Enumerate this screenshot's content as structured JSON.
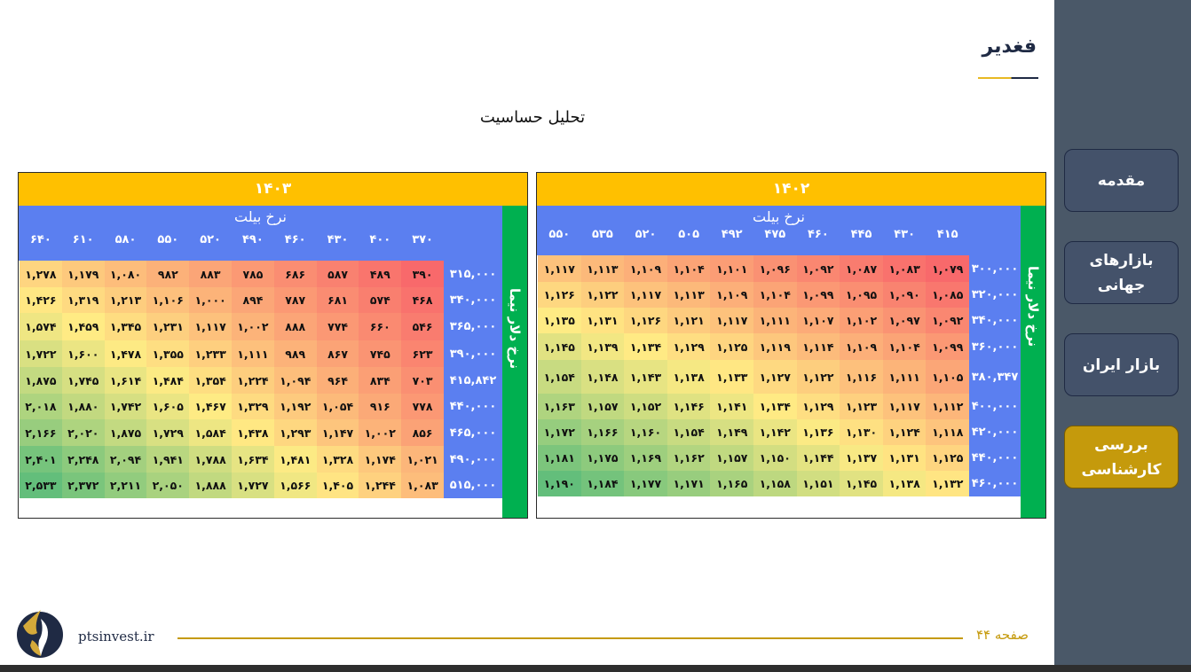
{
  "header": {
    "title": "فغدیر"
  },
  "section_title": "تحلیل حساسیت",
  "sidebar": {
    "items": [
      {
        "label": "مقدمه",
        "active": false
      },
      {
        "label": "بازارهای جهانی",
        "active": false
      },
      {
        "label": "بازار ایران",
        "active": false
      },
      {
        "label": "بررسی کارشناسی",
        "active": true
      }
    ]
  },
  "footer": {
    "site": "ptsinvest.ir",
    "page": "صفحه ۴۴"
  },
  "colors": {
    "accent": "#c59a0c",
    "sidebar": "#4a5868",
    "header_yellow": "#ffc000",
    "header_blue": "#5b7ff0",
    "strip_green": "#00b050"
  },
  "tables": [
    {
      "year": "۱۴۰۲",
      "col_title": "نرخ بیلت",
      "row_title": "نرخ دلار نیما",
      "columns": [
        "۴۱۵",
        "۴۳۰",
        "۴۴۵",
        "۴۶۰",
        "۴۷۵",
        "۴۹۲",
        "۵۰۵",
        "۵۲۰",
        "۵۳۵",
        "۵۵۰"
      ],
      "rows": [
        {
          "label": "۳۰۰,۰۰۰",
          "values": [
            "۱,۰۷۹",
            "۱,۰۸۳",
            "۱,۰۸۷",
            "۱,۰۹۲",
            "۱,۰۹۶",
            "۱,۱۰۱",
            "۱,۱۰۴",
            "۱,۱۰۹",
            "۱,۱۱۳",
            "۱,۱۱۷"
          ]
        },
        {
          "label": "۳۲۰,۰۰۰",
          "values": [
            "۱,۰۸۵",
            "۱,۰۹۰",
            "۱,۰۹۵",
            "۱,۰۹۹",
            "۱,۱۰۴",
            "۱,۱۰۹",
            "۱,۱۱۳",
            "۱,۱۱۷",
            "۱,۱۲۲",
            "۱,۱۲۶"
          ]
        },
        {
          "label": "۳۴۰,۰۰۰",
          "values": [
            "۱,۰۹۲",
            "۱,۰۹۷",
            "۱,۱۰۲",
            "۱,۱۰۷",
            "۱,۱۱۱",
            "۱,۱۱۷",
            "۱,۱۲۱",
            "۱,۱۲۶",
            "۱,۱۳۱",
            "۱,۱۳۵"
          ]
        },
        {
          "label": "۳۶۰,۰۰۰",
          "values": [
            "۱,۰۹۹",
            "۱,۱۰۴",
            "۱,۱۰۹",
            "۱,۱۱۴",
            "۱,۱۱۹",
            "۱,۱۲۵",
            "۱,۱۲۹",
            "۱,۱۳۴",
            "۱,۱۳۹",
            "۱,۱۴۵"
          ]
        },
        {
          "label": "۳۸۰,۳۴۷",
          "values": [
            "۱,۱۰۵",
            "۱,۱۱۱",
            "۱,۱۱۶",
            "۱,۱۲۲",
            "۱,۱۲۷",
            "۱,۱۳۳",
            "۱,۱۳۸",
            "۱,۱۴۳",
            "۱,۱۴۸",
            "۱,۱۵۴"
          ]
        },
        {
          "label": "۴۰۰,۰۰۰",
          "values": [
            "۱,۱۱۲",
            "۱,۱۱۷",
            "۱,۱۲۳",
            "۱,۱۲۹",
            "۱,۱۳۴",
            "۱,۱۴۱",
            "۱,۱۴۶",
            "۱,۱۵۲",
            "۱,۱۵۷",
            "۱,۱۶۳"
          ]
        },
        {
          "label": "۴۲۰,۰۰۰",
          "values": [
            "۱,۱۱۸",
            "۱,۱۲۴",
            "۱,۱۳۰",
            "۱,۱۳۶",
            "۱,۱۴۲",
            "۱,۱۴۹",
            "۱,۱۵۴",
            "۱,۱۶۰",
            "۱,۱۶۶",
            "۱,۱۷۲"
          ]
        },
        {
          "label": "۴۴۰,۰۰۰",
          "values": [
            "۱,۱۲۵",
            "۱,۱۳۱",
            "۱,۱۳۷",
            "۱,۱۴۴",
            "۱,۱۵۰",
            "۱,۱۵۷",
            "۱,۱۶۲",
            "۱,۱۶۹",
            "۱,۱۷۵",
            "۱,۱۸۱"
          ]
        },
        {
          "label": "۴۶۰,۰۰۰",
          "values": [
            "۱,۱۳۲",
            "۱,۱۳۸",
            "۱,۱۴۵",
            "۱,۱۵۱",
            "۱,۱۵۸",
            "۱,۱۶۵",
            "۱,۱۷۱",
            "۱,۱۷۷",
            "۱,۱۸۴",
            "۱,۱۹۰"
          ]
        }
      ]
    },
    {
      "year": "۱۴۰۳",
      "col_title": "نرخ بیلت",
      "row_title": "نرخ دلار نیما",
      "columns": [
        "۳۷۰",
        "۴۰۰",
        "۴۳۰",
        "۴۶۰",
        "۴۹۰",
        "۵۲۰",
        "۵۵۰",
        "۵۸۰",
        "۶۱۰",
        "۶۴۰"
      ],
      "rows": [
        {
          "label": "۳۱۵,۰۰۰",
          "values": [
            "۳۹۰",
            "۴۸۹",
            "۵۸۷",
            "۶۸۶",
            "۷۸۵",
            "۸۸۳",
            "۹۸۲",
            "۱,۰۸۰",
            "۱,۱۷۹",
            "۱,۲۷۸"
          ]
        },
        {
          "label": "۳۴۰,۰۰۰",
          "values": [
            "۴۶۸",
            "۵۷۴",
            "۶۸۱",
            "۷۸۷",
            "۸۹۴",
            "۱,۰۰۰",
            "۱,۱۰۶",
            "۱,۲۱۳",
            "۱,۳۱۹",
            "۱,۴۲۶"
          ]
        },
        {
          "label": "۳۶۵,۰۰۰",
          "values": [
            "۵۴۶",
            "۶۶۰",
            "۷۷۴",
            "۸۸۸",
            "۱,۰۰۲",
            "۱,۱۱۷",
            "۱,۲۳۱",
            "۱,۳۴۵",
            "۱,۴۵۹",
            "۱,۵۷۴"
          ]
        },
        {
          "label": "۳۹۰,۰۰۰",
          "values": [
            "۶۲۳",
            "۷۴۵",
            "۸۶۷",
            "۹۸۹",
            "۱,۱۱۱",
            "۱,۲۳۳",
            "۱,۳۵۵",
            "۱,۴۷۸",
            "۱,۶۰۰",
            "۱,۷۲۲"
          ]
        },
        {
          "label": "۴۱۵,۸۴۲",
          "values": [
            "۷۰۳",
            "۸۳۴",
            "۹۶۴",
            "۱,۰۹۴",
            "۱,۲۲۴",
            "۱,۳۵۴",
            "۱,۴۸۴",
            "۱,۶۱۴",
            "۱,۷۴۵",
            "۱,۸۷۵"
          ]
        },
        {
          "label": "۴۴۰,۰۰۰",
          "values": [
            "۷۷۸",
            "۹۱۶",
            "۱,۰۵۴",
            "۱,۱۹۲",
            "۱,۳۲۹",
            "۱,۴۶۷",
            "۱,۶۰۵",
            "۱,۷۴۲",
            "۱,۸۸۰",
            "۲,۰۱۸"
          ]
        },
        {
          "label": "۴۶۵,۰۰۰",
          "values": [
            "۸۵۶",
            "۱,۰۰۲",
            "۱,۱۴۷",
            "۱,۲۹۳",
            "۱,۴۳۸",
            "۱,۵۸۴",
            "۱,۷۲۹",
            "۱,۸۷۵",
            "۲,۰۲۰",
            "۲,۱۶۶"
          ]
        },
        {
          "label": "۴۹۰,۰۰۰",
          "values": [
            "۱,۰۲۱",
            "۱,۱۷۴",
            "۱,۳۲۸",
            "۱,۴۸۱",
            "۱,۶۳۴",
            "۱,۷۸۸",
            "۱,۹۴۱",
            "۲,۰۹۴",
            "۲,۲۴۸",
            "۲,۴۰۱"
          ]
        },
        {
          "label": "۵۱۵,۰۰۰",
          "values": [
            "۱,۰۸۳",
            "۱,۲۴۴",
            "۱,۴۰۵",
            "۱,۵۶۶",
            "۱,۷۲۷",
            "۱,۸۸۸",
            "۲,۰۵۰",
            "۲,۲۱۱",
            "۲,۳۷۲",
            "۲,۵۳۳"
          ]
        }
      ]
    }
  ]
}
